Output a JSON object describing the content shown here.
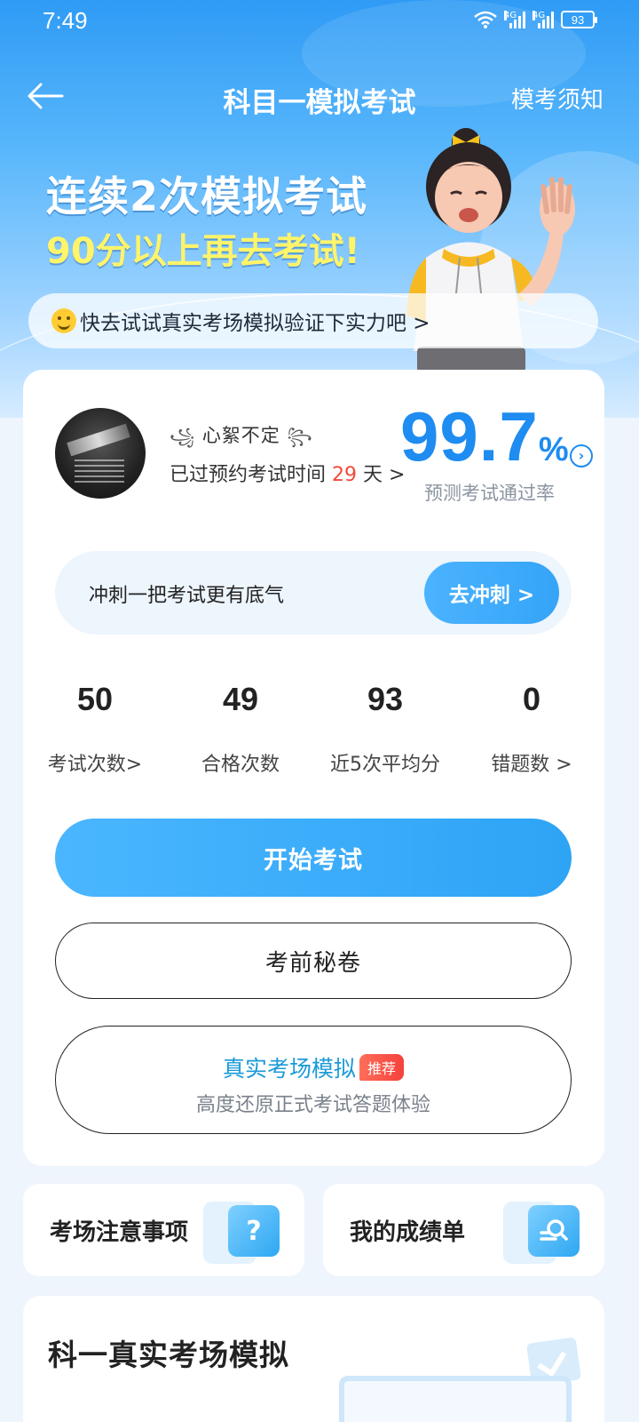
{
  "status_bar": {
    "time": "7:49",
    "signal_label_1": "4G",
    "signal_label_2": "4G",
    "battery": "93"
  },
  "nav": {
    "title": "科目一模拟考试",
    "right_link": "模考须知"
  },
  "banner": {
    "line1": "连续2次模拟考试",
    "line2": "90分以上再去考试!",
    "tip": "快去试试真实考场模拟验证下实力吧 >"
  },
  "profile": {
    "nickname": "心絮不定",
    "exam_prefix": "已过预约考试时间",
    "exam_days": "29",
    "exam_suffix": "天 >"
  },
  "pass_rate": {
    "value": "99.7",
    "unit": "%",
    "label": "预测考试通过率"
  },
  "sprint": {
    "text": "冲刺一把考试更有底气",
    "button": "去冲刺 >"
  },
  "stats": [
    {
      "value": "50",
      "label": "考试次数>"
    },
    {
      "value": "49",
      "label": "合格次数"
    },
    {
      "value": "93",
      "label": "近5次平均分"
    },
    {
      "value": "0",
      "label": "错题数 >"
    }
  ],
  "buttons": {
    "start": "开始考试",
    "secret": "考前秘卷",
    "real_title": "真实考场模拟",
    "real_badge": "推荐",
    "real_sub": "高度还原正式考试答题体验"
  },
  "tiles": [
    {
      "label": "考场注意事项",
      "icon": "question-doc-icon"
    },
    {
      "label": "我的成绩单",
      "icon": "search-doc-icon"
    }
  ],
  "bottom": {
    "title": "科一真实考场模拟"
  },
  "colors": {
    "primary": "#2ea4f5",
    "rate": "#1e8cf0",
    "highlight": "#fff46a",
    "red": "#f04a3c"
  }
}
